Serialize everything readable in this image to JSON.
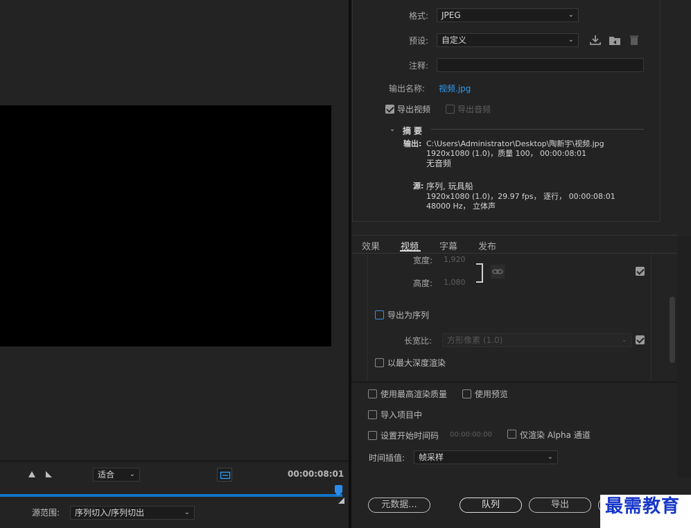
{
  "left": {
    "fit_select": "适合",
    "timecode": "00:00:08:01",
    "source_range_label": "源范围:",
    "source_range_value": "序列切入/序列切出"
  },
  "export": {
    "format_label": "格式:",
    "format_value": "JPEG",
    "preset_label": "预设:",
    "preset_value": "自定义",
    "comments_label": "注释:",
    "comments_value": "",
    "output_name_label": "输出名称:",
    "output_name_value": "视频.jpg",
    "export_video_label": "导出视频",
    "export_video_checked": true,
    "export_audio_label": "导出音频",
    "export_audio_checked": false
  },
  "summary": {
    "title": "摘要",
    "output_label": "输出:",
    "output_lines": [
      "C:\\Users\\Administrator\\Desktop\\陶新宇\\视频.jpg",
      "1920x1080  (1.0)，质量 100， 00:00:08:01",
      "无音频"
    ],
    "source_label": "源:",
    "source_lines": [
      "序列, 玩具船",
      "1920x1080  (1.0)，29.97  fps， 逐行， 00:00:08:01",
      "48000 Hz， 立体声"
    ]
  },
  "tabs": [
    "效果",
    "视频",
    "字幕",
    "发布"
  ],
  "active_tab": "视频",
  "video_settings": {
    "width_label": "宽度:",
    "width_value": "1,920",
    "height_label": "高度:",
    "height_value": "1,080",
    "export_sequence_label": "导出为序列",
    "aspect_label": "长宽比:",
    "aspect_value": "方形像素 (1.0)",
    "max_depth_label": "以最大深度渲染"
  },
  "bottom": {
    "max_quality_label": "使用最高渲染质量",
    "use_preview_label": "使用预览",
    "import_project_label": "导入项目中",
    "set_start_tc_label": "设置开始时间码",
    "start_tc_value": "00:00:00:00",
    "alpha_only_label": "仅渲染 Alpha 通道",
    "interp_label": "时间插值:",
    "interp_value": "帧采样"
  },
  "buttons": {
    "metadata": "元数据...",
    "queue": "队列",
    "export": "导出"
  },
  "watermark": "最需教育",
  "colors": {
    "accent": "#2f9bf5",
    "timeline": "#1473c4",
    "background": "#232323"
  }
}
